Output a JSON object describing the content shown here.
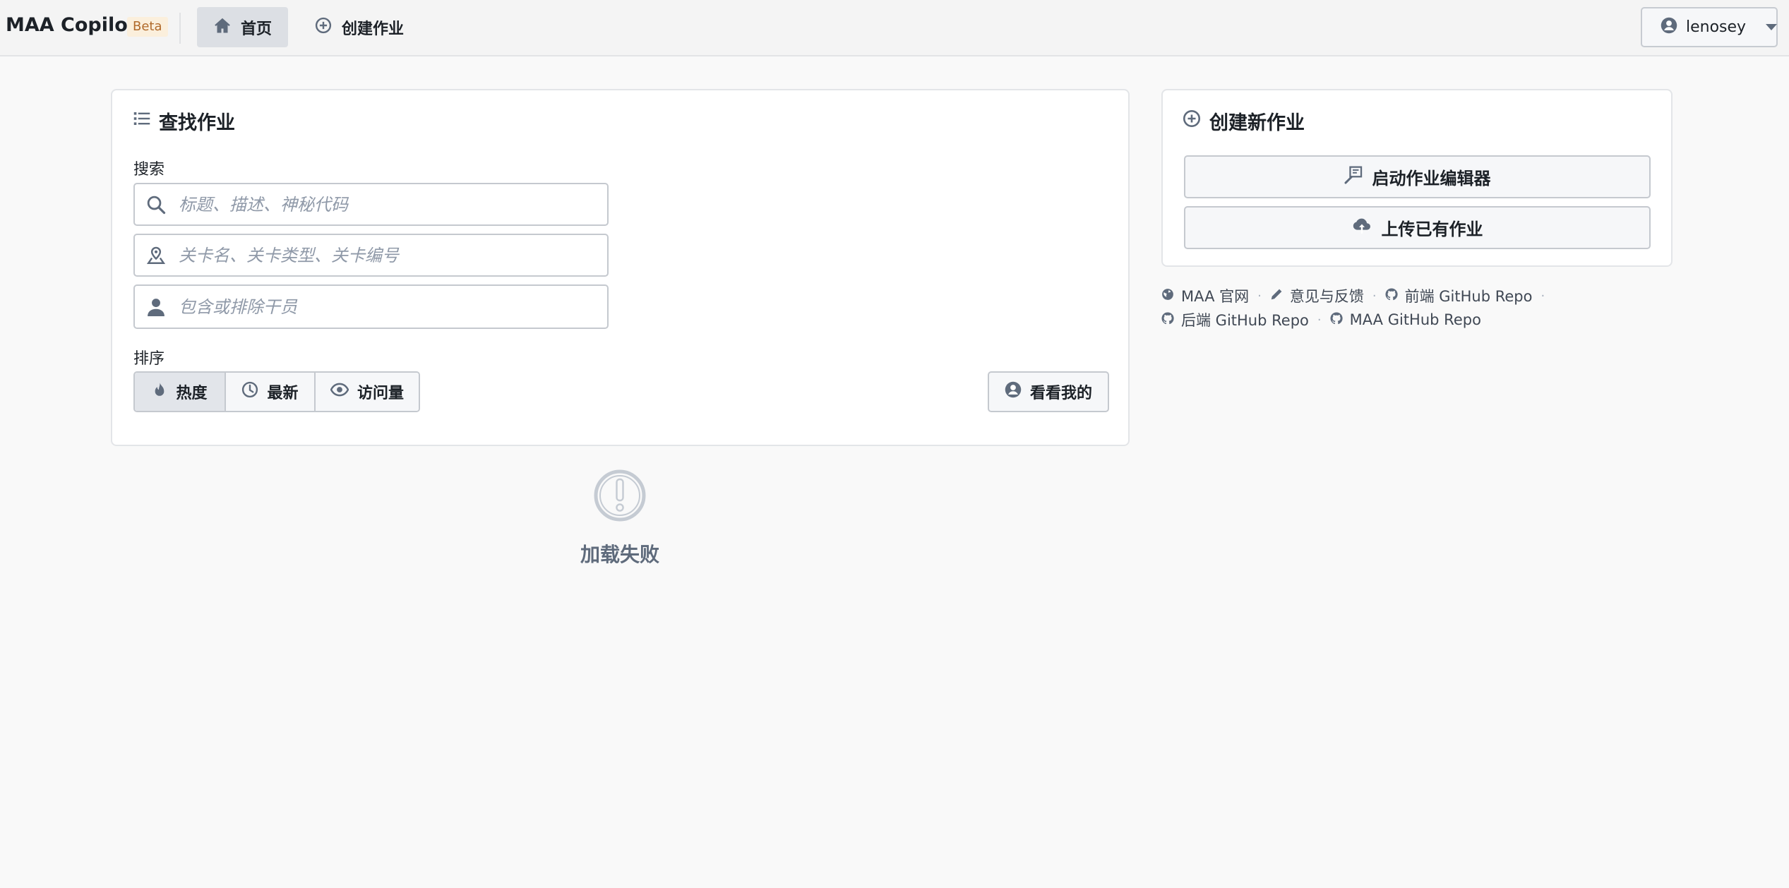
{
  "navbar": {
    "brand": "MAA Copilot",
    "badge": "Beta",
    "items": [
      {
        "label": "首页",
        "icon": "home-icon",
        "active": true
      },
      {
        "label": "创建作业",
        "icon": "add-circle-icon",
        "active": false
      }
    ],
    "user": {
      "name": "lenosey",
      "icon": "user-icon"
    }
  },
  "search_card": {
    "title": "查找作业",
    "search_label": "搜索",
    "inputs": [
      {
        "placeholder": "标题、描述、神秘代码",
        "value": "",
        "icon": "search-icon"
      },
      {
        "placeholder": "关卡名、关卡类型、关卡编号",
        "value": "",
        "icon": "map-marker-icon"
      },
      {
        "placeholder": "包含或排除干员",
        "value": "",
        "icon": "person-icon"
      }
    ],
    "sort_label": "排序",
    "sort_options": [
      {
        "label": "热度",
        "icon": "flame-icon",
        "active": true
      },
      {
        "label": "最新",
        "icon": "time-icon",
        "active": false
      },
      {
        "label": "访问量",
        "icon": "eye-icon",
        "active": false
      }
    ],
    "mine_button": "看看我的"
  },
  "create_card": {
    "title": "创建新作业",
    "buttons": [
      {
        "label": "启动作业编辑器",
        "icon": "edit-document-icon"
      },
      {
        "label": "上传已有作业",
        "icon": "cloud-upload-icon"
      }
    ]
  },
  "links": [
    {
      "label": "MAA 官网",
      "icon": "globe-icon"
    },
    {
      "label": "意见与反馈",
      "icon": "pencil-icon"
    },
    {
      "label": "前端 GitHub Repo",
      "icon": "github-icon"
    },
    {
      "label": "后端 GitHub Repo",
      "icon": "github-icon"
    },
    {
      "label": "MAA GitHub Repo",
      "icon": "github-icon"
    }
  ],
  "error": {
    "text": "加载失败",
    "icon": "error-icon"
  },
  "colors": {
    "background": "#f9f9f9",
    "navbar": "#f4f4f4",
    "active": "#dcdfe4",
    "muted_text": "#5f6b7c",
    "badge_bg": "#fbefdc",
    "badge_text": "#b06a2b"
  }
}
